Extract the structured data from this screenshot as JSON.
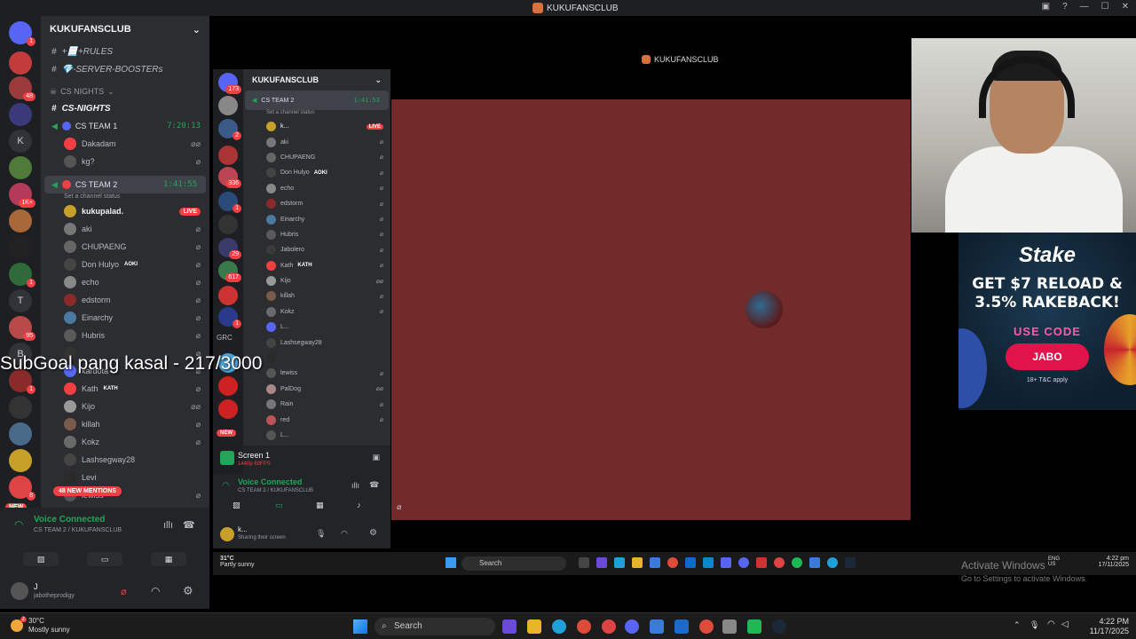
{
  "window": {
    "title": "KUKUFANSCLUB"
  },
  "rail": {
    "badges": [
      "1",
      "48",
      "1K+",
      "1",
      "95",
      "1",
      "8"
    ],
    "letters": [
      "K",
      "T",
      "B"
    ],
    "new_label": "NEW"
  },
  "sidebar": {
    "server_name": "KUKUFANSCLUB",
    "channels": [
      {
        "name": "+📃+RULES"
      },
      {
        "name": "💎-SERVER-BOOSTERs"
      }
    ],
    "category": "CS NIGHTS",
    "category_channel": "CS-NIGHTS",
    "vc1": {
      "name": "CS TEAM 1",
      "time": "7:20:13"
    },
    "vc1_users": [
      "Dakadam",
      "kg?"
    ],
    "vc2": {
      "name": "CS TEAM 2",
      "time": "1:41:55",
      "status": "Set a channel status"
    },
    "vc2_users": [
      {
        "name": "kukupalad.",
        "live": "LIVE"
      },
      {
        "name": "aki"
      },
      {
        "name": "CHUPAENG"
      },
      {
        "name": "Don Hulyo",
        "tag": "AOKI"
      },
      {
        "name": "echo"
      },
      {
        "name": "edstorm"
      },
      {
        "name": "Einarchy"
      },
      {
        "name": "Hubris"
      },
      {
        "name": ""
      },
      {
        "name": "kardota"
      },
      {
        "name": "Kath",
        "tag": "KATH"
      },
      {
        "name": "Kijo"
      },
      {
        "name": "killah"
      },
      {
        "name": "Kokz"
      },
      {
        "name": "Lashsegway28"
      },
      {
        "name": "Levi"
      },
      {
        "name": "lewiss"
      }
    ],
    "mentions": "48 NEW MENTIONS"
  },
  "voice": {
    "title": "Voice Connected",
    "subtitle": "CS TEAM 2 / KUKUFANSCLUB"
  },
  "user": {
    "name": "J",
    "handle": "jabotheprodigy"
  },
  "overlay_text": "SubGoal pang kasal - 217/3000",
  "inner": {
    "title": "KUKUFANSCLUB",
    "server_name": "KUKUFANSCLUB",
    "rail_badges": [
      "173",
      "2",
      "336",
      "1",
      "29",
      "617",
      "1"
    ],
    "rail_letters": [
      "GRC"
    ],
    "rail_new": "NEW",
    "vc": {
      "name": "CS TEAM 2",
      "time": "1:41:53",
      "status": "Set a channel status"
    },
    "users": [
      {
        "name": "k...",
        "live": "LIVE"
      },
      {
        "name": "aki"
      },
      {
        "name": "CHUPAENG"
      },
      {
        "name": "Don Hulyo",
        "tag": "AOKI"
      },
      {
        "name": "echo"
      },
      {
        "name": "edstorm"
      },
      {
        "name": "Einarchy"
      },
      {
        "name": "Hubris"
      },
      {
        "name": "Jabolero"
      },
      {
        "name": "Kath",
        "tag": "KATH"
      },
      {
        "name": "Kijo"
      },
      {
        "name": "killah"
      },
      {
        "name": "Kokz"
      },
      {
        "name": "L..."
      },
      {
        "name": "Lashsegway28"
      },
      {
        "name": ""
      },
      {
        "name": "lewiss"
      },
      {
        "name": "PalDog"
      },
      {
        "name": "Rain"
      },
      {
        "name": "red"
      },
      {
        "name": "L..."
      }
    ],
    "screen": {
      "title": "Screen 1",
      "sub": "1440p 60FPS"
    },
    "voice": {
      "title": "Voice Connected",
      "sub": "CS TEAM 2 / KUKUFANSCLUB"
    },
    "user": {
      "name": "k...",
      "status": "Sharing their screen"
    },
    "taskbar": {
      "temp": "31°C",
      "condition": "Partly sunny",
      "search": "Search",
      "lang1": "ENG",
      "lang2": "US",
      "time": "4:22 pm",
      "date": "17/11/2025"
    }
  },
  "ad": {
    "brand": "Stake",
    "offer_line1": "GET $7 RELOAD &",
    "offer_line2": "3.5% RAKEBACK!",
    "use_code": "USE CODE",
    "code": "JABO",
    "fine": "18+ T&C apply"
  },
  "activate": {
    "line1": "Activate Windows",
    "line2": "Go to Settings to activate Windows."
  },
  "taskbar": {
    "temp": "30°C",
    "condition": "Mostly sunny",
    "search": "Search",
    "time": "4:22 PM",
    "date": "11/17/2025",
    "weather_badge": "2"
  }
}
